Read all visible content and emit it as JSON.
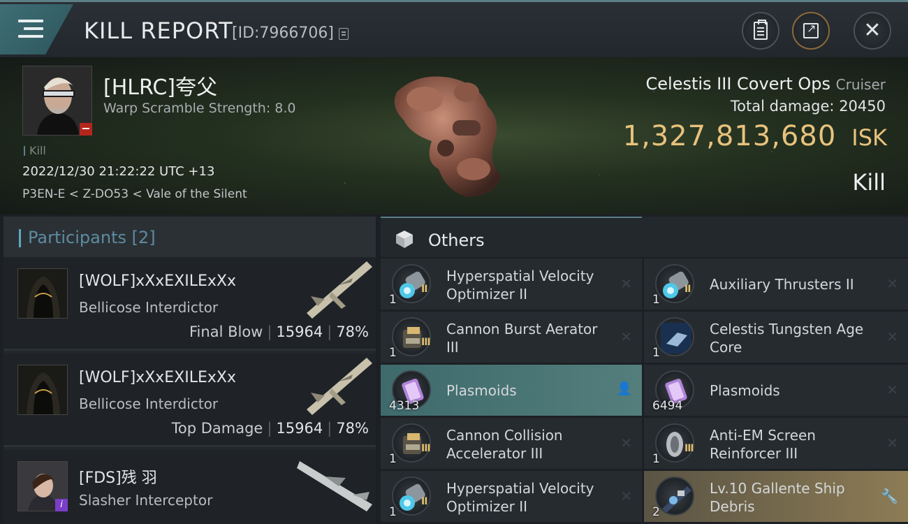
{
  "header": {
    "title": "KILL REPORT",
    "id_text": "[ID:7966706]"
  },
  "victim": {
    "name": "[HLRC]夸父",
    "subtitle": "Warp Scramble Strength: 8.0",
    "kill_tag": "Kill",
    "time": "2022/12/30 21:22:22 UTC +13",
    "location": "P3EN-E < Z-DO53 < Vale of the Silent",
    "ship_name": "Celestis III Covert Ops",
    "ship_class": "Cruiser",
    "total_damage_label": "Total damage:",
    "total_damage_value": "20450",
    "isk_value": "1,327,813,680",
    "isk_unit": "ISK",
    "result": "Kill"
  },
  "participants": {
    "title": "Participants",
    "count": "[2]",
    "rows": [
      {
        "name": "[WOLF]xXxEXILExXx",
        "ship": "Bellicose Interdictor",
        "role": "Final Blow",
        "damage": "15964",
        "percent": "78%"
      },
      {
        "name": "[WOLF]xXxEXILExXx",
        "ship": "Bellicose Interdictor",
        "role": "Top Damage",
        "damage": "15964",
        "percent": "78%"
      },
      {
        "name": "[FDS]残 羽",
        "ship": "Slasher Interceptor"
      }
    ]
  },
  "others": {
    "title": "Others",
    "items": [
      {
        "qty": "1",
        "name": "Hyperspatial Velocity Optimizer II",
        "tier": "II"
      },
      {
        "qty": "1",
        "name": "Auxiliary Thrusters II",
        "tier": "II"
      },
      {
        "qty": "1",
        "name": "Cannon Burst Aerator III",
        "tier": "III"
      },
      {
        "qty": "1",
        "name": "Celestis Tungsten Age Core",
        "tier": ""
      },
      {
        "qty": "4313",
        "name": "Plasmoids",
        "tier": ""
      },
      {
        "qty": "6494",
        "name": "Plasmoids",
        "tier": ""
      },
      {
        "qty": "1",
        "name": "Cannon Collision Accelerator III",
        "tier": "III"
      },
      {
        "qty": "1",
        "name": "Anti-EM Screen Reinforcer III",
        "tier": "III"
      },
      {
        "qty": "1",
        "name": "Hyperspatial Velocity Optimizer II",
        "tier": "II"
      },
      {
        "qty": "2",
        "name": "Lv.10 Gallente Ship Debris",
        "tier": ""
      }
    ]
  },
  "colors": {
    "accent": "#5ea8c4",
    "isk": "#e8c27c",
    "highlight": "#537e7c",
    "gold": "#8d7c55"
  },
  "icons": [
    "menu-icon",
    "copy-icon",
    "clipboard-icon",
    "share-icon",
    "close-icon",
    "cube-icon",
    "person-icon",
    "wrench-icon",
    "remove-icon"
  ]
}
